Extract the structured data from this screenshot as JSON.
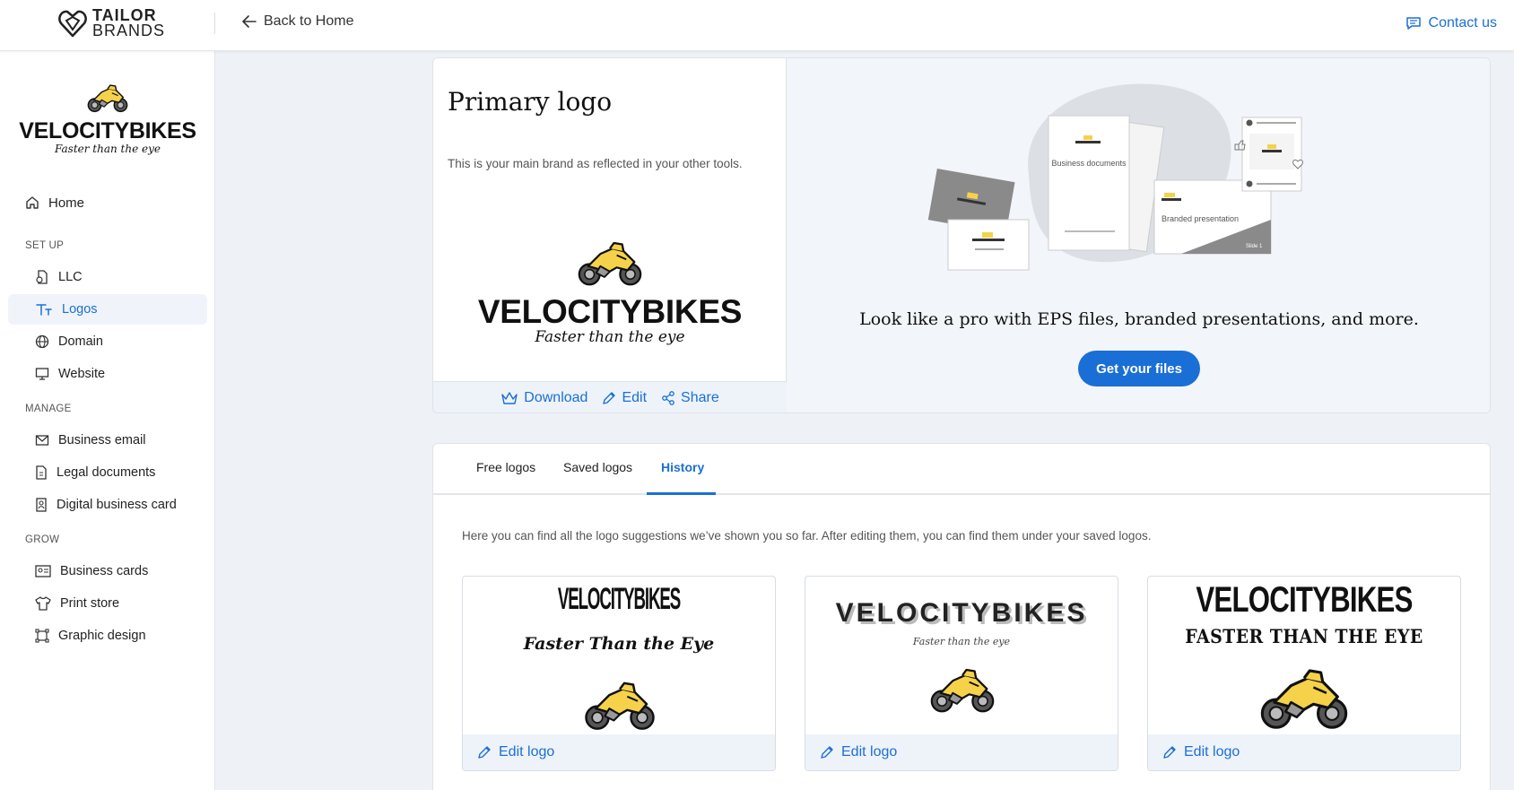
{
  "header": {
    "brand_line1": "TAILOR",
    "brand_line2": "BRANDS",
    "back_label": "Back to Home",
    "contact_label": "Contact us"
  },
  "sidebar": {
    "logo_name": "VELOCITYBIKES",
    "logo_tagline": "Faster than the eye",
    "home_label": "Home",
    "sections": {
      "setup": "SET UP",
      "manage": "MANAGE",
      "grow": "GROW"
    },
    "items": [
      {
        "label": "LLC",
        "icon": "document-icon"
      },
      {
        "label": "Logos",
        "icon": "text-icon",
        "active": true
      },
      {
        "label": "Domain",
        "icon": "globe-icon"
      },
      {
        "label": "Website",
        "icon": "monitor-icon"
      },
      {
        "label": "Business email",
        "icon": "mail-icon"
      },
      {
        "label": "Legal documents",
        "icon": "legal-doc-icon"
      },
      {
        "label": "Digital business card",
        "icon": "id-card-icon"
      },
      {
        "label": "Business cards",
        "icon": "business-card-icon"
      },
      {
        "label": "Print store",
        "icon": "tshirt-icon"
      },
      {
        "label": "Graphic design",
        "icon": "crop-frame-icon"
      }
    ]
  },
  "primary": {
    "title": "Primary logo",
    "description": "This is your main brand as reflected in your other tools.",
    "logo_name": "VELOCITYBIKES",
    "logo_tagline": "Faster than the eye",
    "actions": {
      "download": "Download",
      "edit": "Edit",
      "share": "Share"
    },
    "promo": {
      "mock_business_docs": "Business documents",
      "mock_presentation": "Branded presentation",
      "mock_slide": "Slide 1",
      "headline": "Look like a pro with EPS files, branded presentations, and more.",
      "cta": "Get your files"
    }
  },
  "history": {
    "tabs": [
      "Free logos",
      "Saved logos",
      "History"
    ],
    "active_tab": "History",
    "description": "Here you can find all the logo suggestions we’ve shown you so far. After editing them, you can find them under your saved logos.",
    "cards": [
      {
        "name": "VELOCITYBIKES",
        "tagline": "Faster Than the Eye",
        "edit_label": "Edit logo"
      },
      {
        "name": "VELOCITYBIKES",
        "tagline": "Faster than the eye",
        "edit_label": "Edit logo"
      },
      {
        "name": "VELOCITYBIKES",
        "tagline": "FASTER THAN THE EYE",
        "edit_label": "Edit logo"
      }
    ]
  },
  "colors": {
    "accent": "#1a6fd6",
    "moto_yellow": "#f5d24a",
    "page_bg": "#eef2f6"
  }
}
